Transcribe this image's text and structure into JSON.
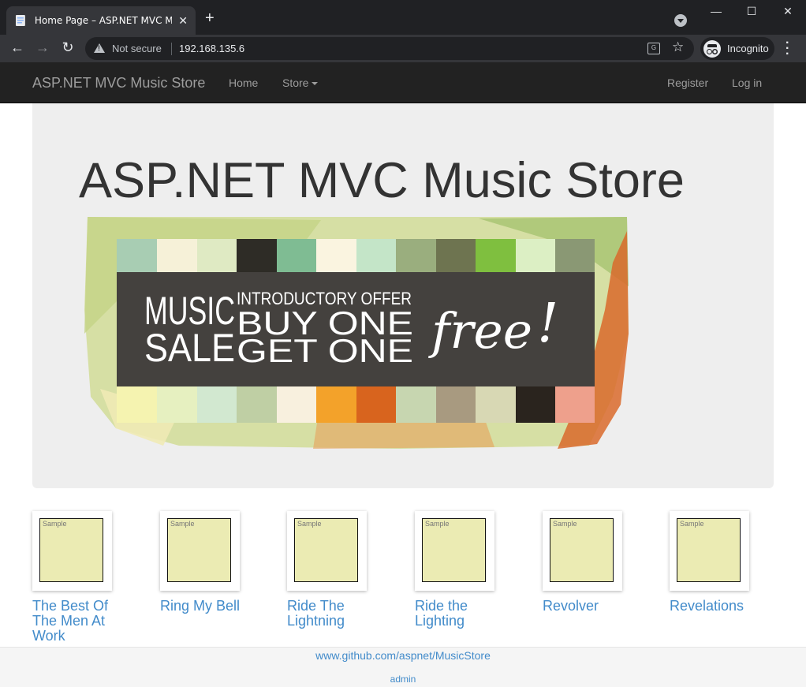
{
  "browser": {
    "tab_title": "Home Page – ASP.NET MVC Music Store",
    "address": {
      "security_label": "Not secure",
      "url": "192.168.135.6"
    },
    "profile_label": "Incognito"
  },
  "site": {
    "brand": "ASP.NET MVC Music Store",
    "nav_left": [
      "Home",
      "Store"
    ],
    "nav_right": [
      "Register",
      "Log in"
    ],
    "hero_title": "ASP.NET MVC Music Store",
    "banner": {
      "word1": "MUSIC",
      "word2": "SALE",
      "offer_line": "INTRODUCTORY OFFER",
      "buy_line": "BUY ONE",
      "get_line": "GET ONE",
      "script_word": "free",
      "bang": "!"
    },
    "albums": [
      {
        "title": "The Best Of The Men At Work",
        "art_label": "Sample"
      },
      {
        "title": "Ring My Bell",
        "art_label": "Sample"
      },
      {
        "title": "Ride The Lightning",
        "art_label": "Sample"
      },
      {
        "title": "Ride the Lighting",
        "art_label": "Sample"
      },
      {
        "title": "Revolver",
        "art_label": "Sample"
      },
      {
        "title": "Revelations",
        "art_label": "Sample"
      }
    ],
    "footer": {
      "link": "www.github.com/aspnet/MusicStore",
      "admin": "admin"
    }
  },
  "colors": {
    "navbar_bg": "#222222",
    "link": "#428bca",
    "jumbotron_bg": "#eeeeee",
    "banner_dark": "#44413e"
  }
}
